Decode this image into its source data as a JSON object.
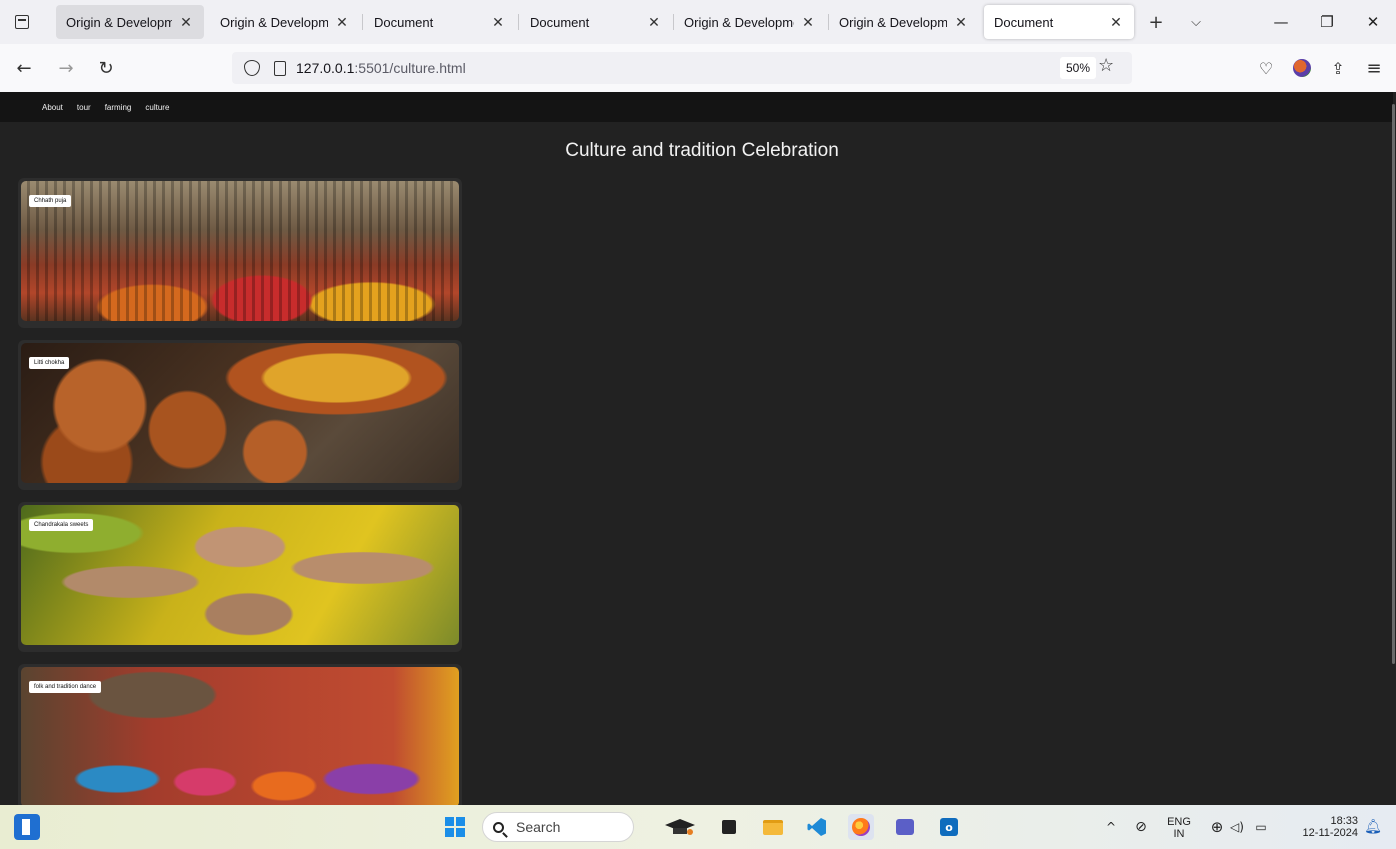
{
  "browser": {
    "tabs": [
      {
        "title": "Origin & Developme",
        "state": "hovered"
      },
      {
        "title": "Origin & Developmen",
        "state": "normal"
      },
      {
        "title": "Document",
        "state": "normal"
      },
      {
        "title": "Document",
        "state": "normal"
      },
      {
        "title": "Origin & Developmen",
        "state": "normal"
      },
      {
        "title": "Origin & Developmen",
        "state": "normal"
      },
      {
        "title": "Document",
        "state": "active"
      }
    ],
    "url_host": "127.0.0.1",
    "url_rest": ":5501/culture.html",
    "zoom": "50%"
  },
  "site": {
    "nav": [
      "About",
      "tour",
      "farming",
      "culture"
    ],
    "title": "Culture and tradition Celebration",
    "cards": [
      {
        "label": "Chhath puja"
      },
      {
        "label": "Litti chokha"
      },
      {
        "label": "Chandrakala sweets"
      },
      {
        "label": "folk and tradition dance"
      }
    ]
  },
  "taskbar": {
    "search_label": "Search",
    "lang_top": "ENG",
    "lang_bottom": "IN",
    "time": "18:33",
    "date": "12-11-2024"
  },
  "colors": {
    "page_bg": "#222222",
    "site_nav_bg": "#141414",
    "card_bg": "#2d2d2d"
  }
}
